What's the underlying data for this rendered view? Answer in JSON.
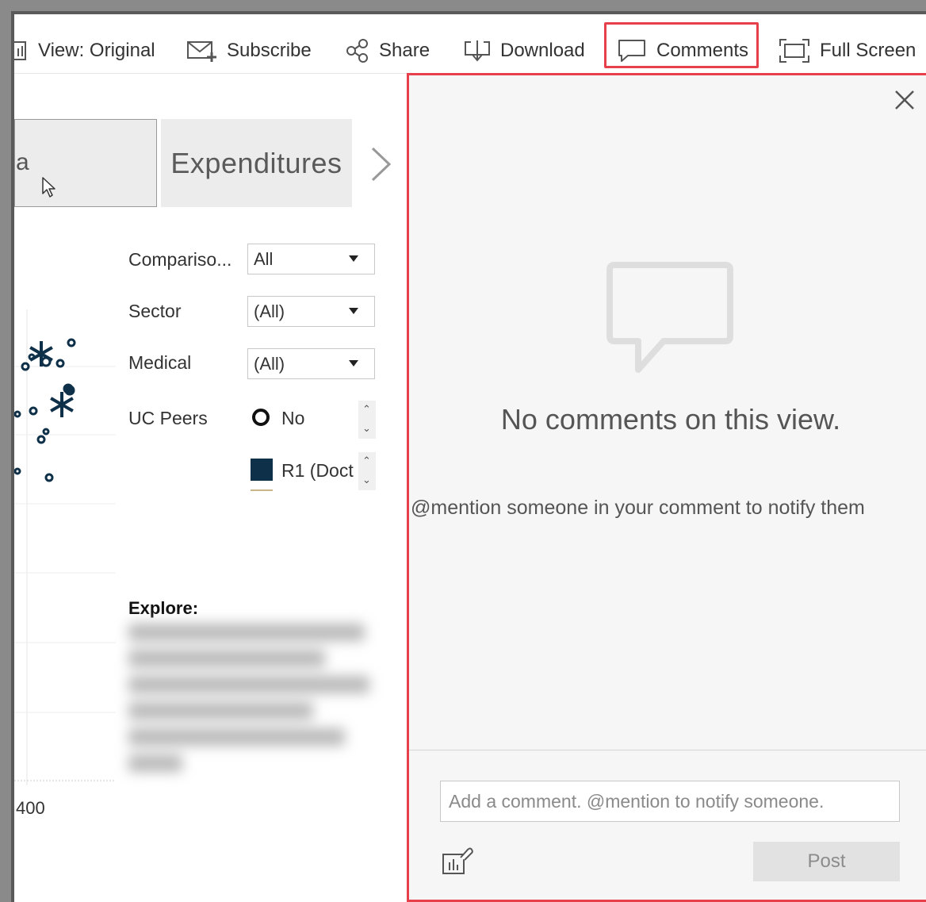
{
  "toolbar": {
    "view_label": "View: Original",
    "subscribe_label": "Subscribe",
    "share_label": "Share",
    "download_label": "Download",
    "comments_label": "Comments",
    "fullscreen_label": "Full Screen"
  },
  "tabs": {
    "active_fragment": "a",
    "expenditures_label": "Expenditures"
  },
  "filters": {
    "comparison": {
      "label": "Compariso...",
      "value": "All"
    },
    "sector": {
      "label": "Sector",
      "value": "(All)"
    },
    "medical": {
      "label": "Medical",
      "value": "(All)"
    },
    "uc_peers": {
      "label": "UC Peers",
      "option": "No"
    }
  },
  "legend": {
    "item_label": "R1 (Doct",
    "item_color": "#0f3049"
  },
  "chart": {
    "axis_tick": "400",
    "marker_color": "#0f3049"
  },
  "explore": {
    "label": "Explore:"
  },
  "comments_panel": {
    "empty_title": "No comments on this view.",
    "empty_hint": "@mention someone in your comment to notify them",
    "input_placeholder": "Add a comment. @mention to notify someone.",
    "post_label": "Post",
    "highlight_color": "#e8404a"
  }
}
